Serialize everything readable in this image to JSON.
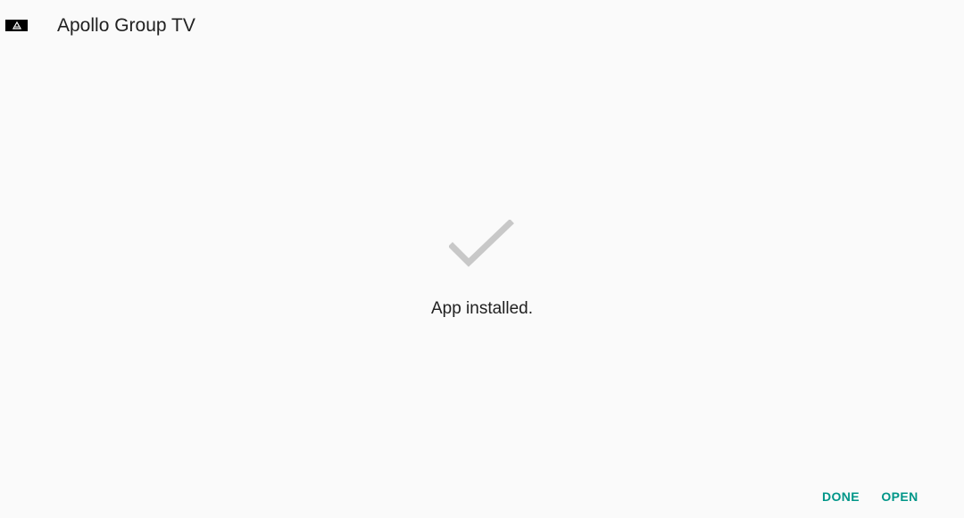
{
  "app_bar": {
    "title": "Apollo Group TV",
    "icon": "apollo-app-icon"
  },
  "status": {
    "icon": "checkmark-icon",
    "message": "App installed."
  },
  "actions": {
    "done_label": "DONE",
    "open_label": "OPEN"
  },
  "colors": {
    "background": "#fafafa",
    "text": "#212121",
    "accent": "#009688",
    "checkmark": "#c8c8c8",
    "icon_background": "#000000"
  }
}
